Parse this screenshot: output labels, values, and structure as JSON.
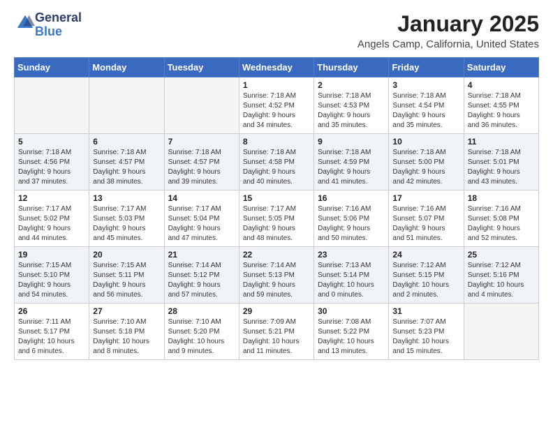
{
  "header": {
    "logo_general": "General",
    "logo_blue": "Blue",
    "month_year": "January 2025",
    "location": "Angels Camp, California, United States"
  },
  "weekdays": [
    "Sunday",
    "Monday",
    "Tuesday",
    "Wednesday",
    "Thursday",
    "Friday",
    "Saturday"
  ],
  "weeks": [
    [
      {
        "day": "",
        "info": ""
      },
      {
        "day": "",
        "info": ""
      },
      {
        "day": "",
        "info": ""
      },
      {
        "day": "1",
        "info": "Sunrise: 7:18 AM\nSunset: 4:52 PM\nDaylight: 9 hours\nand 34 minutes."
      },
      {
        "day": "2",
        "info": "Sunrise: 7:18 AM\nSunset: 4:53 PM\nDaylight: 9 hours\nand 35 minutes."
      },
      {
        "day": "3",
        "info": "Sunrise: 7:18 AM\nSunset: 4:54 PM\nDaylight: 9 hours\nand 35 minutes."
      },
      {
        "day": "4",
        "info": "Sunrise: 7:18 AM\nSunset: 4:55 PM\nDaylight: 9 hours\nand 36 minutes."
      }
    ],
    [
      {
        "day": "5",
        "info": "Sunrise: 7:18 AM\nSunset: 4:56 PM\nDaylight: 9 hours\nand 37 minutes."
      },
      {
        "day": "6",
        "info": "Sunrise: 7:18 AM\nSunset: 4:57 PM\nDaylight: 9 hours\nand 38 minutes."
      },
      {
        "day": "7",
        "info": "Sunrise: 7:18 AM\nSunset: 4:57 PM\nDaylight: 9 hours\nand 39 minutes."
      },
      {
        "day": "8",
        "info": "Sunrise: 7:18 AM\nSunset: 4:58 PM\nDaylight: 9 hours\nand 40 minutes."
      },
      {
        "day": "9",
        "info": "Sunrise: 7:18 AM\nSunset: 4:59 PM\nDaylight: 9 hours\nand 41 minutes."
      },
      {
        "day": "10",
        "info": "Sunrise: 7:18 AM\nSunset: 5:00 PM\nDaylight: 9 hours\nand 42 minutes."
      },
      {
        "day": "11",
        "info": "Sunrise: 7:18 AM\nSunset: 5:01 PM\nDaylight: 9 hours\nand 43 minutes."
      }
    ],
    [
      {
        "day": "12",
        "info": "Sunrise: 7:17 AM\nSunset: 5:02 PM\nDaylight: 9 hours\nand 44 minutes."
      },
      {
        "day": "13",
        "info": "Sunrise: 7:17 AM\nSunset: 5:03 PM\nDaylight: 9 hours\nand 45 minutes."
      },
      {
        "day": "14",
        "info": "Sunrise: 7:17 AM\nSunset: 5:04 PM\nDaylight: 9 hours\nand 47 minutes."
      },
      {
        "day": "15",
        "info": "Sunrise: 7:17 AM\nSunset: 5:05 PM\nDaylight: 9 hours\nand 48 minutes."
      },
      {
        "day": "16",
        "info": "Sunrise: 7:16 AM\nSunset: 5:06 PM\nDaylight: 9 hours\nand 50 minutes."
      },
      {
        "day": "17",
        "info": "Sunrise: 7:16 AM\nSunset: 5:07 PM\nDaylight: 9 hours\nand 51 minutes."
      },
      {
        "day": "18",
        "info": "Sunrise: 7:16 AM\nSunset: 5:08 PM\nDaylight: 9 hours\nand 52 minutes."
      }
    ],
    [
      {
        "day": "19",
        "info": "Sunrise: 7:15 AM\nSunset: 5:10 PM\nDaylight: 9 hours\nand 54 minutes."
      },
      {
        "day": "20",
        "info": "Sunrise: 7:15 AM\nSunset: 5:11 PM\nDaylight: 9 hours\nand 56 minutes."
      },
      {
        "day": "21",
        "info": "Sunrise: 7:14 AM\nSunset: 5:12 PM\nDaylight: 9 hours\nand 57 minutes."
      },
      {
        "day": "22",
        "info": "Sunrise: 7:14 AM\nSunset: 5:13 PM\nDaylight: 9 hours\nand 59 minutes."
      },
      {
        "day": "23",
        "info": "Sunrise: 7:13 AM\nSunset: 5:14 PM\nDaylight: 10 hours\nand 0 minutes."
      },
      {
        "day": "24",
        "info": "Sunrise: 7:12 AM\nSunset: 5:15 PM\nDaylight: 10 hours\nand 2 minutes."
      },
      {
        "day": "25",
        "info": "Sunrise: 7:12 AM\nSunset: 5:16 PM\nDaylight: 10 hours\nand 4 minutes."
      }
    ],
    [
      {
        "day": "26",
        "info": "Sunrise: 7:11 AM\nSunset: 5:17 PM\nDaylight: 10 hours\nand 6 minutes."
      },
      {
        "day": "27",
        "info": "Sunrise: 7:10 AM\nSunset: 5:18 PM\nDaylight: 10 hours\nand 8 minutes."
      },
      {
        "day": "28",
        "info": "Sunrise: 7:10 AM\nSunset: 5:20 PM\nDaylight: 10 hours\nand 9 minutes."
      },
      {
        "day": "29",
        "info": "Sunrise: 7:09 AM\nSunset: 5:21 PM\nDaylight: 10 hours\nand 11 minutes."
      },
      {
        "day": "30",
        "info": "Sunrise: 7:08 AM\nSunset: 5:22 PM\nDaylight: 10 hours\nand 13 minutes."
      },
      {
        "day": "31",
        "info": "Sunrise: 7:07 AM\nSunset: 5:23 PM\nDaylight: 10 hours\nand 15 minutes."
      },
      {
        "day": "",
        "info": ""
      }
    ]
  ]
}
